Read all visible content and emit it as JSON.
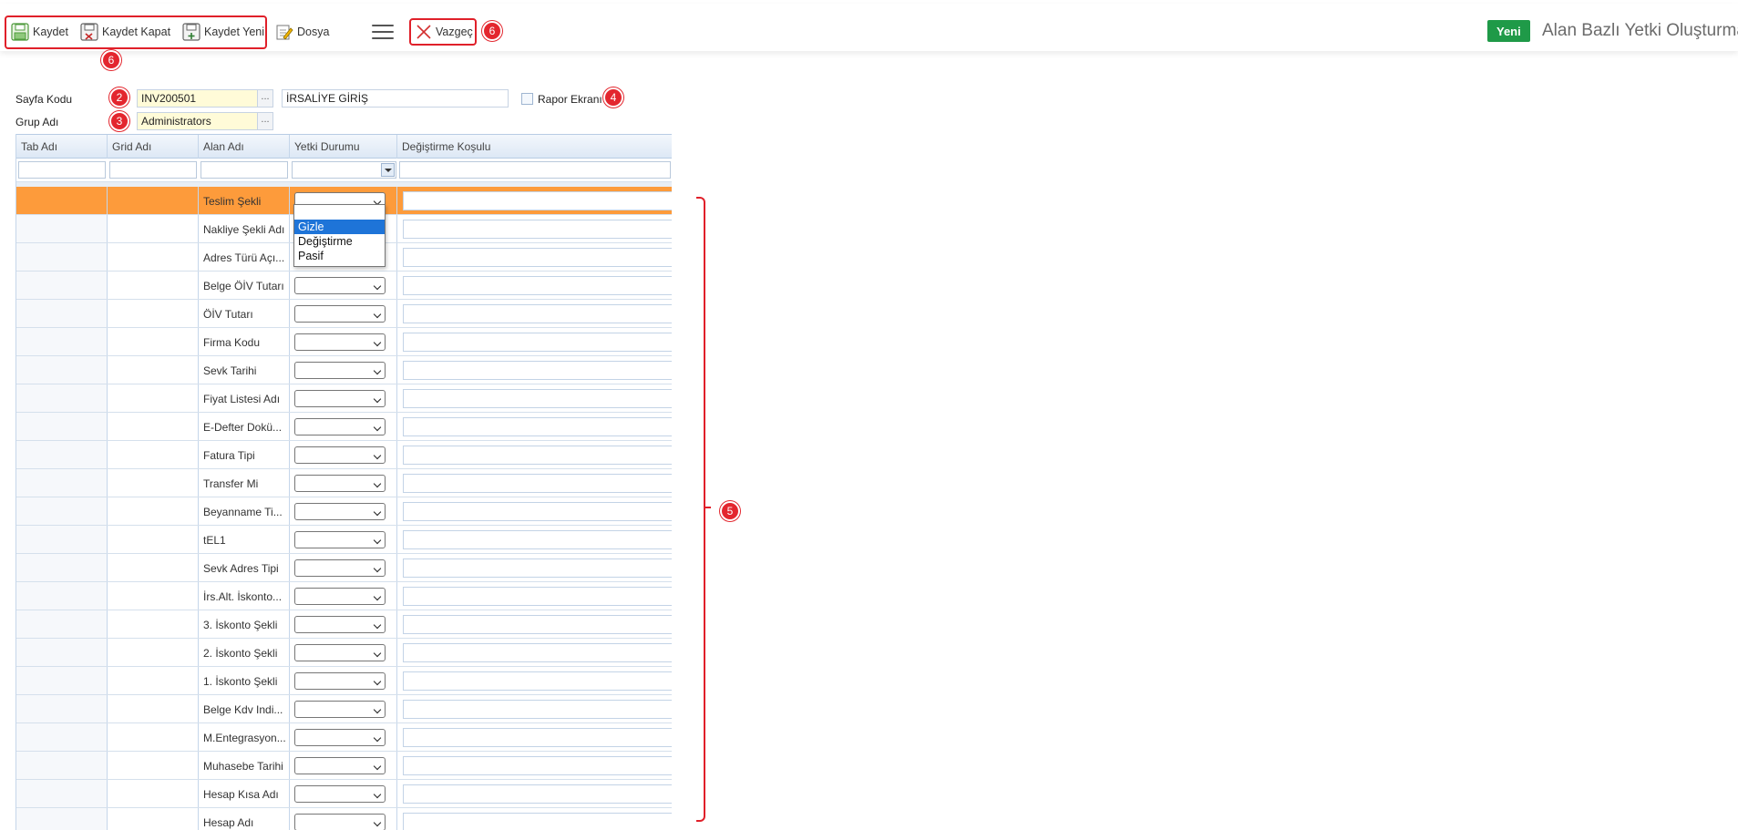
{
  "toolbar": {
    "save": "Kaydet",
    "save_close": "Kaydet Kapat",
    "save_new": "Kaydet Yeni",
    "file": "Dosya",
    "cancel": "Vazgeç"
  },
  "header": {
    "status_badge": "Yeni",
    "title": "Alan Bazlı Yetki Oluşturma"
  },
  "markers": {
    "m2": "2",
    "m3": "3",
    "m4": "4",
    "m5": "5",
    "m6a": "6",
    "m6b": "6"
  },
  "form": {
    "page_code_label": "Sayfa Kodu",
    "page_code_value": "INV200501",
    "page_name_value": "İRSALİYE GİRİŞ",
    "report_screen_label": "Rapor Ekranı",
    "group_label": "Grup Adı",
    "group_value": "Administrators",
    "ellipsis": "..."
  },
  "grid": {
    "columns": [
      "Tab Adı",
      "Grid Adı",
      "Alan Adı",
      "Yetki Durumu",
      "Değiştirme Koşulu"
    ],
    "rows": [
      "Teslim Şekli",
      "Nakliye Şekli Adı",
      "Adres Türü Açı...",
      "Belge ÖİV Tutarı",
      "ÖİV Tutarı",
      "Firma Kodu",
      "Sevk Tarihi",
      "Fiyat Listesi Adı",
      "E-Defter Dokü...",
      "Fatura Tipi",
      "Transfer Mi",
      "Beyanname Ti...",
      "tEL1",
      "Sevk Adres Tipi",
      "İrs.Alt. İskonto...",
      "3. İskonto Şekli",
      "2. İskonto Şekli",
      "1. İskonto Şekli",
      "Belge Kdv Indi...",
      "M.Entegrasyon...",
      "Muhasebe Tarihi",
      "Hesap Kısa Adı",
      "Hesap Adı"
    ],
    "selected_row_index": 0,
    "dropdown_options": [
      "",
      "Gizle",
      "Değiştirme",
      "Pasif"
    ],
    "highlighted_option": "Gizle"
  },
  "colors": {
    "selected_row": "#fd9b3b",
    "marker_red": "#e3262e",
    "new_badge": "#1f9a48",
    "dropdown_highlight": "#1e74d8"
  }
}
